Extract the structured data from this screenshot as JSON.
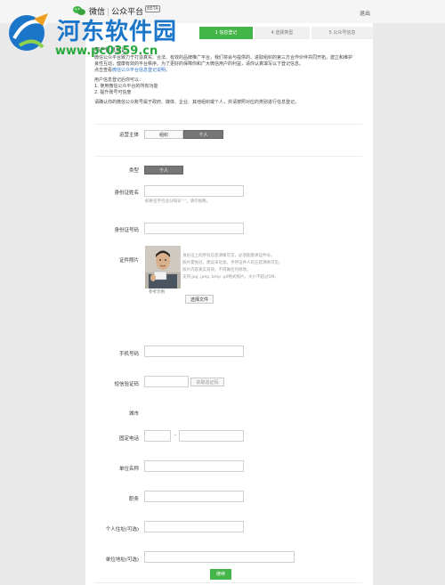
{
  "watermark": {
    "title": "河东软件园",
    "url": "www.pc0359.cn"
  },
  "header": {
    "brand_name": "微信",
    "brand_separator": "|",
    "brand_product": "公众平台",
    "brand_tag": "BETA",
    "logout_label": "退出"
  },
  "steps": [
    {
      "label": "1 信息登记",
      "active": true
    },
    {
      "label": "4 选择类型",
      "active": false
    },
    {
      "label": "5 公众号信息",
      "active": false
    }
  ],
  "intro": {
    "heading": "用户信息登记",
    "para1_line1": "微信公众平台致力于打造真实、合法、有效的品牌推广平台，我们将会与提供的、进取组织的第三方合作伙伴共同开拓，建立和维护",
    "para1_line2": "良性互动，健康有效的平台秩序。为了更好的保障你和广大微信用户的利益，请你认真填写以下登记信息。",
    "link_prefix": "点击查看",
    "link_text": "微信公众平台信息登记说明。",
    "list_title": "用户信息登记后你可以：",
    "list_item_1": "1. 使用微信公众平台的所有功能",
    "list_item_2": "2. 提升账号可信度",
    "para2": "请确认你的微信公众账号属于政府、媒体、企业、其他组织或个人，并请按照对应的类别进行信息登记。"
  },
  "form": {
    "operator_label": "运营主体",
    "operator_options": [
      "组织",
      "个人"
    ],
    "operator_selected": "个人",
    "type_label": "类型",
    "type_value": "个人",
    "id_name_label": "身份证姓名",
    "id_name_hint": "如果名字包含分隔号\"·\"，请勿省略。",
    "id_number_label": "身份证号码",
    "id_photo_label": "证件照片",
    "photo_caption": "参考示例",
    "photo_note_1": "身份证上的所有信息清晰可见，必须能看清证件号。",
    "photo_note_2": "照片需免冠，建议未化妆，手持证件人的五官清晰可见。",
    "photo_note_3": "照片内容真实有效，不得做任何修改。",
    "photo_note_4": "支持.jpg .jpeg .bmp .gif格式照片，大小不超过5M。",
    "choose_file_label": "选择文件",
    "phone_label": "手机号码",
    "sms_code_label": "短信验证码",
    "get_code_label": "获取验证码",
    "city_label": "城市",
    "landline_label": "固定电话",
    "landline_separator": "-",
    "employer_label": "单位名称",
    "position_label": "职务",
    "home_address_label": "个人住址(可选)",
    "work_address_label": "单位地址(可选)",
    "submit_label": "继续"
  }
}
